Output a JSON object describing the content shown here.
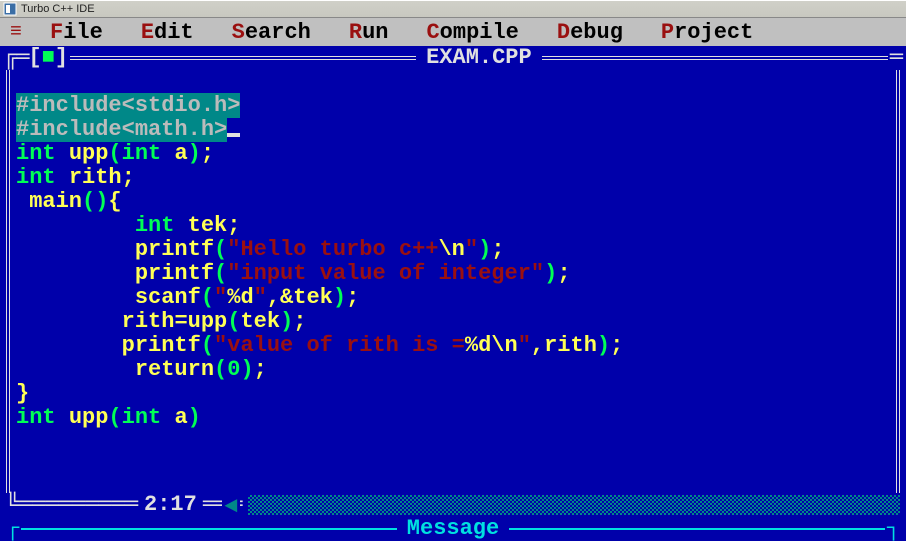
{
  "window": {
    "title": "Turbo C++ IDE"
  },
  "menu": {
    "file": "ile",
    "file_hk": "F",
    "edit": "dit",
    "edit_hk": "E",
    "search": "earch",
    "search_hk": "S",
    "run": "un",
    "run_hk": "R",
    "compile": "ompile",
    "compile_hk": "C",
    "debug": "ebug",
    "debug_hk": "D",
    "project": "roject",
    "project_hk": "P"
  },
  "editor": {
    "filename": "EXAM.CPP",
    "cursor_position": "2:17"
  },
  "code": {
    "l1": "#include<stdio.h>",
    "l2": "#include<math.h>",
    "l3_int": "int ",
    "l3_fn": "upp",
    "l3_rest1": "(",
    "l3_int2": "int ",
    "l3_a": "a",
    "l3_rest2": ")",
    "l3_semi": ";",
    "l4_int": "int ",
    "l4_id": "rith;",
    "l5_main": " main",
    "l5_p": "()",
    "l5_b": "{",
    "l6_sp": "         ",
    "l6_int": "int ",
    "l6_id": "tek;",
    "l7_sp": "         ",
    "l7_fn": "printf",
    "l7_p1": "(",
    "l7_str": "\"Hello turbo c++",
    "l7_fmt": "\\n",
    "l7_str2": "\"",
    "l7_p2": ")",
    "l7_semi": ";",
    "l8_sp": "         ",
    "l8_fn": "printf",
    "l8_p1": "(",
    "l8_str": "\"input value of integer\"",
    "l8_p2": ")",
    "l8_semi": ";",
    "l9_sp": "         ",
    "l9_fn": "scanf",
    "l9_p1": "(",
    "l9_q1": "\"",
    "l9_fmt": "%d",
    "l9_q2": "\"",
    "l9_c": ",&tek",
    "l9_p2": ")",
    "l9_semi": ";",
    "l10_sp": "        ",
    "l10_lhs": "rith",
    "l10_eq": "=",
    "l10_fn": "upp",
    "l10_p1": "(",
    "l10_arg": "tek",
    "l10_p2": ")",
    "l10_semi": ";",
    "l11_sp": "        ",
    "l11_fn": "printf",
    "l11_p1": "(",
    "l11_str1": "\"value of rith is =",
    "l11_fmt": "%d\\n",
    "l11_str2": "\"",
    "l11_c": ",rith",
    "l11_p2": ")",
    "l11_semi": ";",
    "l12_sp": "         ",
    "l12_ret": "return",
    "l12_p1": "(",
    "l12_n": "0",
    "l12_p2": ")",
    "l12_semi": ";",
    "l13": "}",
    "l14_int": "int ",
    "l14_fn": "upp",
    "l14_p1": "(",
    "l14_int2": "int ",
    "l14_a": "a",
    "l14_p2": ")"
  },
  "message_panel": {
    "label": "Message"
  }
}
